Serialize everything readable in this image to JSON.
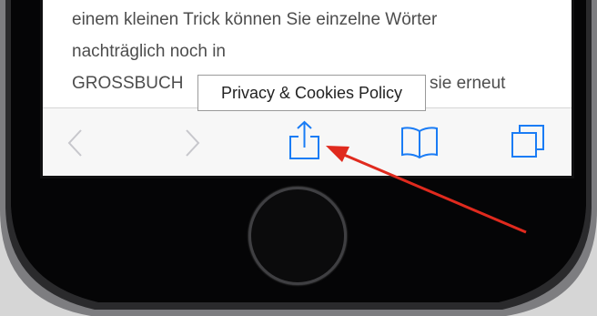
{
  "article": {
    "line1": "einem kleinen Trick können Sie einzelne Wörter",
    "line2": "nachträglich noch in",
    "line3_start": "GROSSBUCH",
    "line3_end": "sie erneut"
  },
  "popup": {
    "label": "Privacy & Cookies Policy"
  },
  "toolbar": {
    "back_icon": "chevron-left-icon",
    "forward_icon": "chevron-right-icon",
    "share_icon": "share-icon",
    "bookmarks_icon": "book-icon",
    "tabs_icon": "tabs-icon",
    "icon_color": "#1a7cf5",
    "disabled_color": "#c7c7cc"
  },
  "annotation": {
    "arrow_color": "#e02a1e",
    "points_to": "share-button"
  }
}
